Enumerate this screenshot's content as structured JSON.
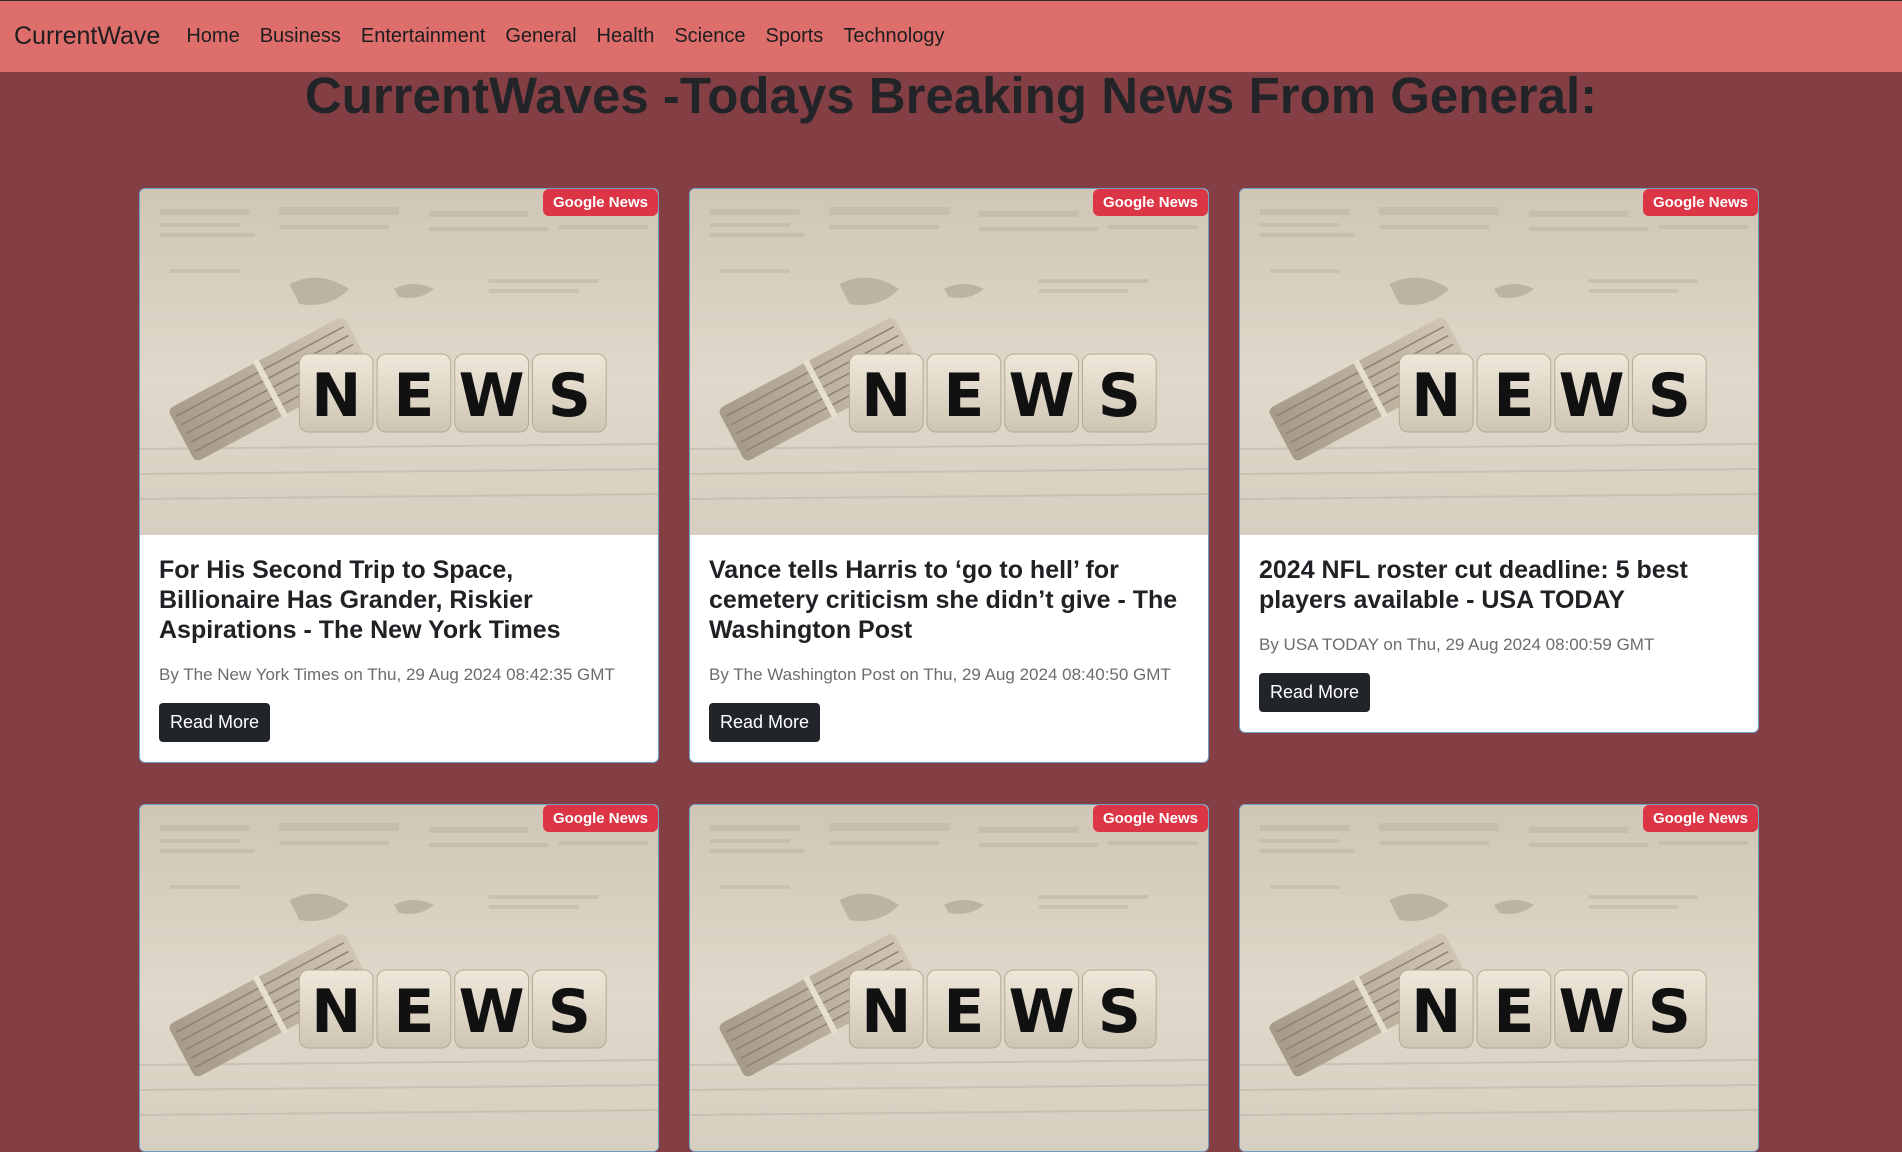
{
  "nav": {
    "brand": "CurrentWave",
    "links": [
      "Home",
      "Business",
      "Entertainment",
      "General",
      "Health",
      "Science",
      "Sports",
      "Technology"
    ]
  },
  "page": {
    "title": "CurrentWaves -Todays Breaking News From General:"
  },
  "colors": {
    "navbar": "#de6e6c",
    "background": "#833f44",
    "badge": "#dc3545",
    "button": "#212529"
  },
  "icons": {
    "thumbnail": "news-dice-image"
  },
  "articles": [
    {
      "source_badge": "Google News",
      "title": "For His Second Trip to Space, Billionaire Has Grander, Riskier Aspirations - The New York Times",
      "meta": "By The New York Times on Thu, 29 Aug 2024 08:42:35 GMT",
      "button": "Read More"
    },
    {
      "source_badge": "Google News",
      "title": "Vance tells Harris to ‘go to hell’ for cemetery criticism she didn’t give - The Washington Post",
      "meta": "By The Washington Post on Thu, 29 Aug 2024 08:40:50 GMT",
      "button": "Read More"
    },
    {
      "source_badge": "Google News",
      "title": "2024 NFL roster cut deadline: 5 best players available - USA TODAY",
      "meta": "By USA TODAY on Thu, 29 Aug 2024 08:00:59 GMT",
      "button": "Read More"
    },
    {
      "source_badge": "Google News"
    },
    {
      "source_badge": "Google News"
    },
    {
      "source_badge": "Google News"
    }
  ]
}
